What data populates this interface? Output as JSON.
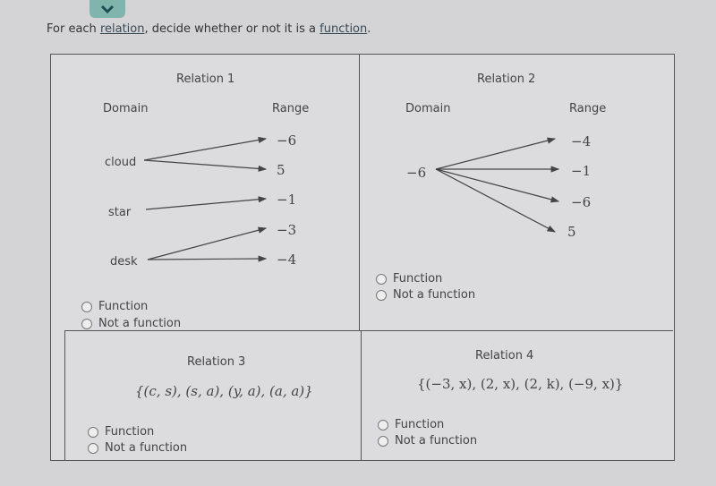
{
  "prompt": {
    "before": "For each ",
    "link1": "relation",
    "middle": ", decide whether or not it is a ",
    "link2": "function",
    "after": "."
  },
  "toggle_icon": "chevron-down-icon",
  "accent": "#7fb5ad",
  "relations": [
    {
      "title": "Relation 1",
      "domain_label": "Domain",
      "range_label": "Range",
      "domain": [
        "cloud",
        "star",
        "desk"
      ],
      "range": [
        "−6",
        "5",
        "−1",
        "−3",
        "−4"
      ],
      "mappings": [
        [
          "cloud",
          "−6"
        ],
        [
          "cloud",
          "5"
        ],
        [
          "star",
          "−1"
        ],
        [
          "desk",
          "−3"
        ],
        [
          "desk",
          "−4"
        ]
      ],
      "options": [
        "Function",
        "Not a function"
      ]
    },
    {
      "title": "Relation 2",
      "domain_label": "Domain",
      "range_label": "Range",
      "domain": [
        "−6"
      ],
      "range": [
        "−4",
        "−1",
        "−6",
        "5"
      ],
      "mappings": [
        [
          "−6",
          "−4"
        ],
        [
          "−6",
          "−1"
        ],
        [
          "−6",
          "−6"
        ],
        [
          "−6",
          "5"
        ]
      ],
      "options": [
        "Function",
        "Not a function"
      ]
    },
    {
      "title": "Relation 3",
      "set": "{(c, s), (s, a), (y, a), (a, a)}",
      "options": [
        "Function",
        "Not a function"
      ]
    },
    {
      "title": "Relation 4",
      "set": "{(−3, x), (2, x), (2, k), (−9, x)}",
      "options": [
        "Function",
        "Not a function"
      ]
    }
  ]
}
